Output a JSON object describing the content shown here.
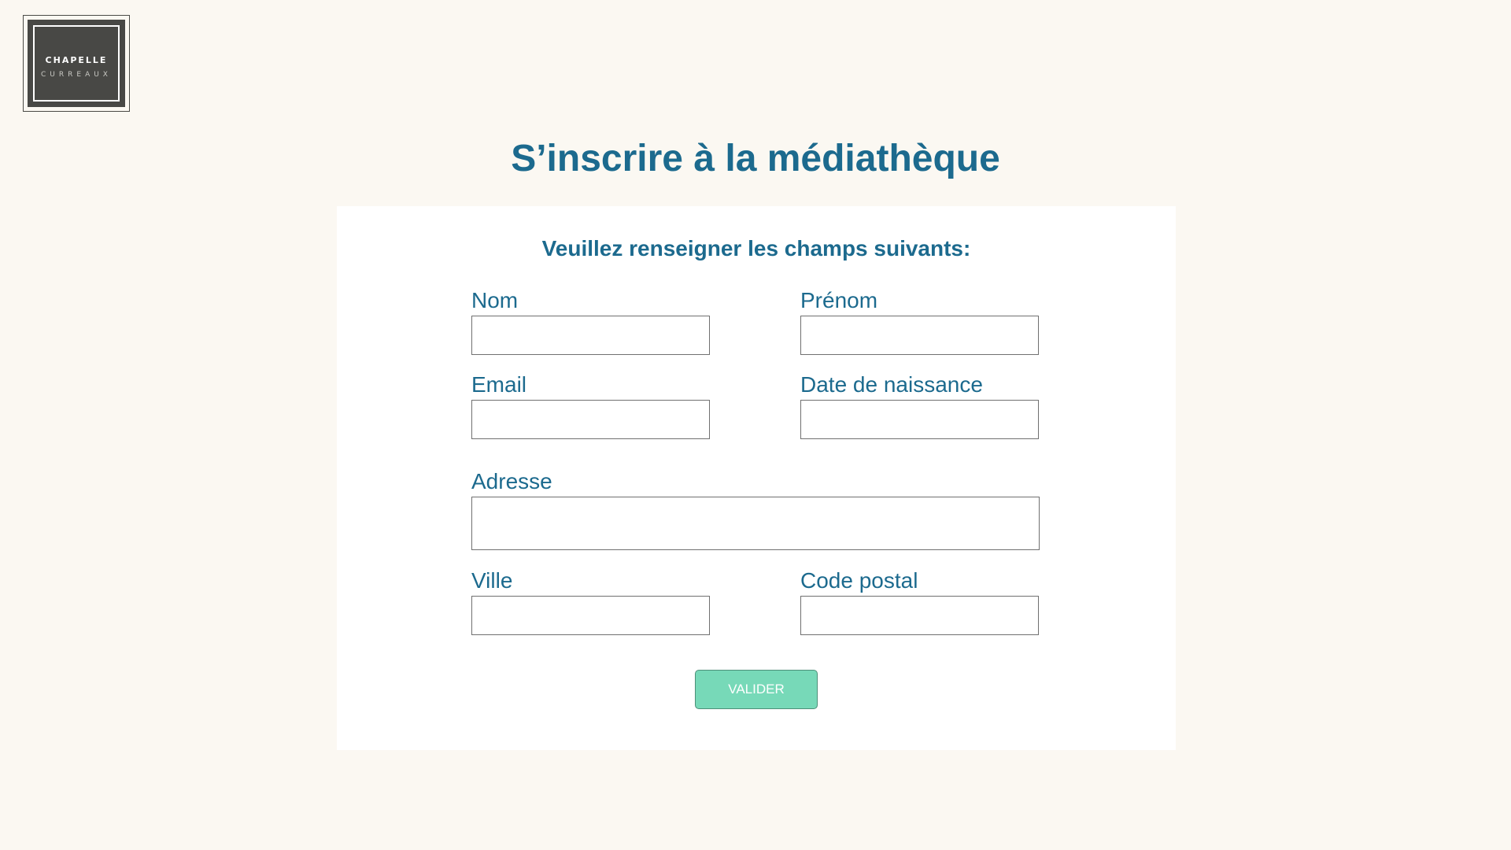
{
  "logo": {
    "line1": "CHAPELLE",
    "line2": "CURREAUX"
  },
  "page": {
    "title": "S’inscrire à la médiathèque",
    "subtitle": "Veuillez renseigner les champs suivants:"
  },
  "form": {
    "nom": {
      "label": "Nom",
      "value": ""
    },
    "prenom": {
      "label": "Prénom",
      "value": ""
    },
    "email": {
      "label": "Email",
      "value": ""
    },
    "date_naissance": {
      "label": "Date de naissance",
      "value": ""
    },
    "adresse": {
      "label": "Adresse",
      "value": ""
    },
    "ville": {
      "label": "Ville",
      "value": ""
    },
    "code_postal": {
      "label": "Code postal",
      "value": ""
    },
    "submit_label": "VALIDER"
  },
  "colors": {
    "background": "#fbf8f2",
    "card": "#ffffff",
    "accent_text": "#1c6a8e",
    "button": "#77d9b8",
    "logo": "#484845"
  }
}
